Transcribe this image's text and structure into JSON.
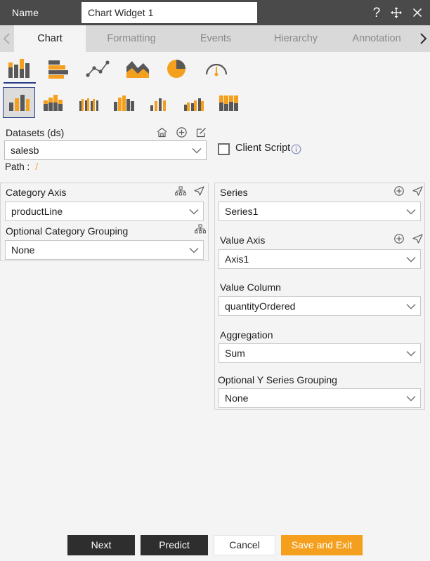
{
  "titlebar": {
    "name_label": "Name",
    "widget_name": "Chart Widget 1",
    "icons": {
      "help": "help-icon",
      "move": "move-icon",
      "close": "close-icon"
    }
  },
  "tabs": {
    "prev_arrow": "chevron-left-icon",
    "next_arrow": "chevron-right-icon",
    "items": [
      {
        "label": "Chart",
        "active": true
      },
      {
        "label": "Formatting",
        "active": false
      },
      {
        "label": "Events",
        "active": false
      },
      {
        "label": "Hierarchy",
        "active": false
      },
      {
        "label": "Annotation",
        "active": false
      }
    ]
  },
  "chart_types_primary": [
    {
      "name": "column-chart-icon",
      "selected": true
    },
    {
      "name": "bar-chart-icon",
      "selected": false
    },
    {
      "name": "line-scatter-chart-icon",
      "selected": false
    },
    {
      "name": "area-chart-icon",
      "selected": false
    },
    {
      "name": "pie-chart-icon",
      "selected": false
    },
    {
      "name": "gauge-chart-icon",
      "selected": false
    }
  ],
  "chart_types_secondary": [
    {
      "name": "column-simple-icon",
      "selected": true
    },
    {
      "name": "column-stacked-icon",
      "selected": false
    },
    {
      "name": "column-grouped-thin-icon",
      "selected": false
    },
    {
      "name": "column-clustered-icon",
      "selected": false
    },
    {
      "name": "column-mixed-icon",
      "selected": false
    },
    {
      "name": "column-small-multiples-icon",
      "selected": false
    },
    {
      "name": "column-stacked-full-icon",
      "selected": false
    }
  ],
  "datasets": {
    "label": "Datasets (ds)",
    "home_icon": "home-icon",
    "add_icon": "plus-circle-icon",
    "edit_icon": "edit-pencil-icon",
    "value": "salesb",
    "path_label": "Path :",
    "path_value": "/"
  },
  "client_script": {
    "label": "Client Script",
    "checked": false,
    "info_icon": "info-icon"
  },
  "left_panel": {
    "category_axis": {
      "label": "Category Axis",
      "value": "productLine",
      "tree_icon": "hierarchy-tree-icon",
      "send_icon": "send-arrow-icon"
    },
    "category_grouping": {
      "label": "Optional Category Grouping",
      "value": "None",
      "tree_icon": "hierarchy-tree-icon"
    }
  },
  "right_panel": {
    "series": {
      "label": "Series",
      "value": "Series1",
      "add_icon": "plus-circle-icon",
      "send_icon": "send-arrow-icon"
    },
    "value_axis": {
      "label": "Value Axis",
      "value": "Axis1",
      "add_icon": "plus-circle-icon",
      "send_icon": "send-arrow-icon"
    },
    "value_column": {
      "label": "Value Column",
      "value": "quantityOrdered"
    },
    "aggregation": {
      "label": "Aggregation",
      "value": "Sum"
    },
    "y_series_grouping": {
      "label": "Optional Y Series Grouping",
      "value": "None"
    }
  },
  "footer": {
    "next": "Next",
    "predict": "Predict",
    "cancel": "Cancel",
    "save_exit": "Save and Exit"
  },
  "colors": {
    "accent_orange": "#f4a01e",
    "header_dark": "#4a4a4a",
    "tab_bg": "#d9d9d9",
    "body_bg": "#f4f4f4",
    "select_blue": "#2c3e86",
    "icon_gray": "#585858"
  }
}
